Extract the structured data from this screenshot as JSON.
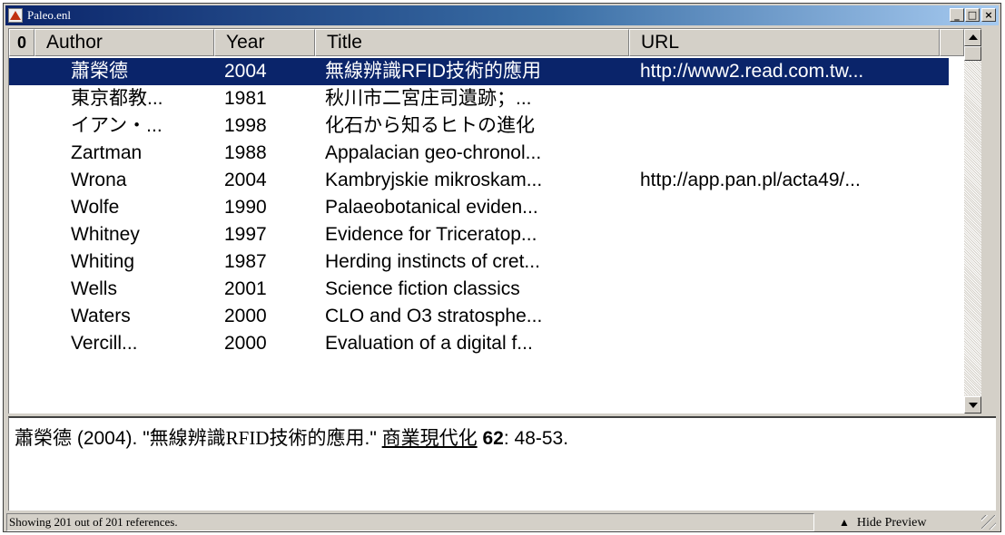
{
  "window": {
    "title": "Paleo.enl"
  },
  "title_buttons": {
    "minimize": "_",
    "maximize": "□",
    "close": "×"
  },
  "columns": {
    "attach": "0",
    "author": "Author",
    "year": "Year",
    "title": "Title",
    "url": "URL"
  },
  "rows": [
    {
      "author": "蕭榮德",
      "year": "2004",
      "title": "無線辨識RFID技術的應用",
      "url": "http://www2.read.com.tw..."
    },
    {
      "author": "東京都教...",
      "year": "1981",
      "title": "秋川市二宮庄司遺跡；...",
      "url": ""
    },
    {
      "author": "イアン・...",
      "year": "1998",
      "title": "化石から知るヒトの進化",
      "url": ""
    },
    {
      "author": "Zartman",
      "year": "1988",
      "title": "Appalacian geo-chronol...",
      "url": ""
    },
    {
      "author": "Wrona",
      "year": "2004",
      "title": "Kambryjskie mikroskam...",
      "url": "http://app.pan.pl/acta49/..."
    },
    {
      "author": "Wolfe",
      "year": "1990",
      "title": "Palaeobotanical eviden...",
      "url": ""
    },
    {
      "author": "Whitney",
      "year": "1997",
      "title": "Evidence for Triceratop...",
      "url": ""
    },
    {
      "author": "Whiting",
      "year": "1987",
      "title": "Herding instincts of cret...",
      "url": ""
    },
    {
      "author": "Wells",
      "year": "2001",
      "title": "Science fiction classics",
      "url": ""
    },
    {
      "author": "Waters",
      "year": "2000",
      "title": "CLO and O3 stratosphe...",
      "url": ""
    },
    {
      "author": "Vercill...",
      "year": "2000",
      "title": "Evaluation of a digital f...",
      "url": ""
    }
  ],
  "preview": {
    "author_year": "蕭榮德 (2004). \"",
    "title_cjk": "無線辨識",
    "title_latin": "RFID",
    "title_rest": "技術的應用.\" ",
    "journal": "商業現代化",
    "volume": "62",
    "pages": ": 48-53."
  },
  "status": {
    "text": "Showing 201 out of 201 references.",
    "hide_preview": "Hide Preview"
  },
  "colors": {
    "selection": "#0a246a",
    "titlebar_start": "#0a246a",
    "titlebar_end": "#a6caf0"
  }
}
